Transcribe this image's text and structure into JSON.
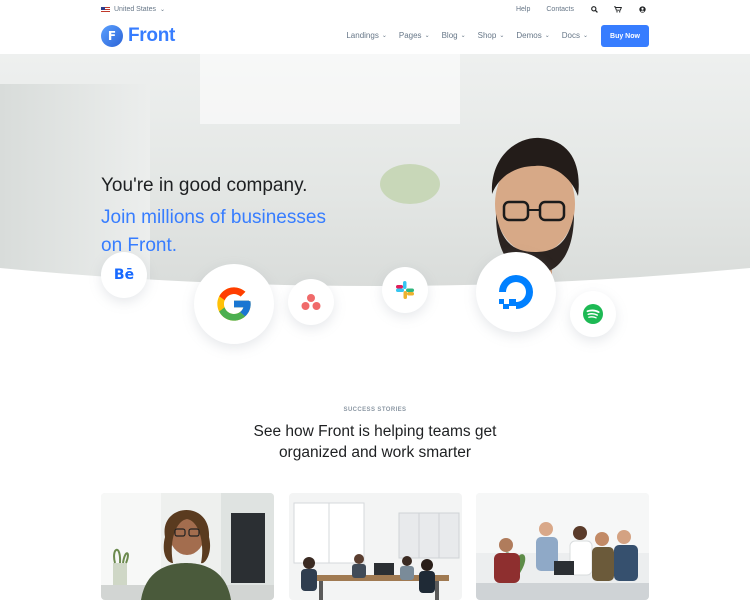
{
  "topbar": {
    "region": "United States",
    "links": [
      "Help",
      "Contacts"
    ],
    "icons": [
      "search-icon",
      "cart-icon",
      "user-icon"
    ]
  },
  "header": {
    "brand": "Front",
    "brand_mark": "F",
    "nav": [
      "Landings",
      "Pages",
      "Blog",
      "Shop",
      "Demos",
      "Docs"
    ],
    "buy_label": "Buy Now"
  },
  "hero": {
    "title": "You're in good company.",
    "subtitle_line1": "Join millions of businesses",
    "subtitle_line2": "on Front."
  },
  "brand_logos": [
    "behance-logo",
    "google-logo",
    "asana-logo",
    "slack-logo",
    "digitalocean-logo",
    "spotify-logo"
  ],
  "brand_logo_texts": {
    "behance": "Bē"
  },
  "stories": {
    "eyebrow": "SUCCESS STORIES",
    "title_line1": "See how Front is helping teams get",
    "title_line2": "organized and work smarter"
  },
  "colors": {
    "accent": "#377dff",
    "text": "#1e2022",
    "muted": "#677788"
  }
}
